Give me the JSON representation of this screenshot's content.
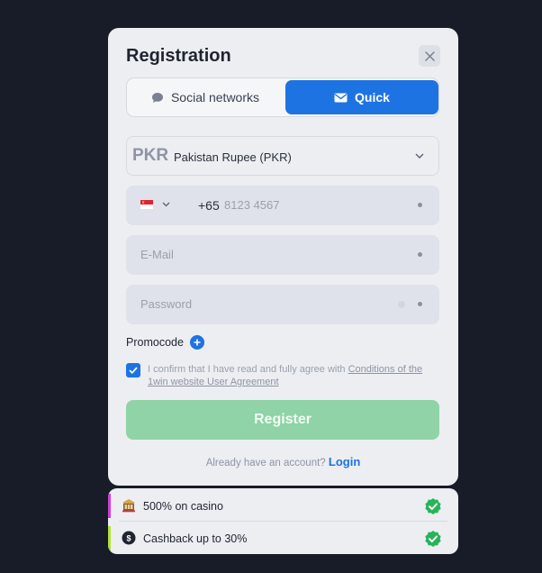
{
  "registration": {
    "title": "Registration",
    "tabs": [
      {
        "label": "Social networks",
        "icon": "chat-bubble-icon",
        "active": false
      },
      {
        "label": "Quick",
        "icon": "envelope-icon",
        "active": true
      }
    ],
    "currency": {
      "code": "PKR",
      "name": "Pakistan Rupee (PKR)"
    },
    "phone": {
      "country_icon": "singapore-flag-icon",
      "dial_code": "+65",
      "placeholder": "8123 4567"
    },
    "email": {
      "placeholder": "E-Mail"
    },
    "password": {
      "placeholder": "Password"
    },
    "promocode_label": "Promocode",
    "agreement": {
      "checked": true,
      "text": "I confirm that I have read and fully agree with ",
      "link": "Conditions of the 1win website User Agreement"
    },
    "register_label": "Register",
    "login_prompt": "Already have an account?",
    "login_link": "Login"
  },
  "bonuses": [
    {
      "label": "500% on casino",
      "icon": "casino-icon",
      "stripe_color": "#d13fd6"
    },
    {
      "label": "Cashback up to 30%",
      "icon": "cashback-icon",
      "stripe_color": "#b4e23a"
    }
  ],
  "colors": {
    "background": "#181c29",
    "panel": "#eceef2",
    "accent": "#1e73e3",
    "register_button": "#8fd3a6",
    "check_badge": "#27b35a"
  }
}
